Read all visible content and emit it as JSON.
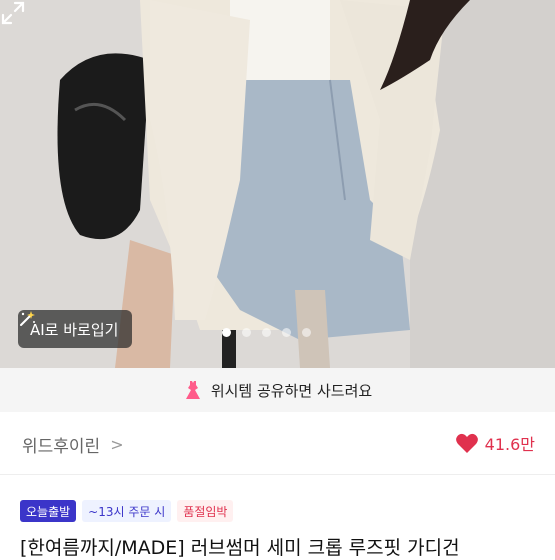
{
  "photo": {
    "ai_button_label": "AI로 바로입기",
    "carousel": {
      "count": 5,
      "active_index": 0
    }
  },
  "share_bar": {
    "text": "위시템 공유하면 사드려요"
  },
  "shop": {
    "name": "위드후이린",
    "chevron": ">"
  },
  "likes": {
    "count": "41.6만"
  },
  "badges": [
    {
      "label": "오늘출발"
    },
    {
      "label": "~13시 주문 시"
    },
    {
      "label": "품절임박"
    }
  ],
  "product": {
    "title": "[한여름까지/MADE] 러브썸머 세미 크롭 루즈핏 가디건"
  },
  "colors": {
    "accent_pink": "#e0314e",
    "badge_blue": "#3b35c9"
  }
}
